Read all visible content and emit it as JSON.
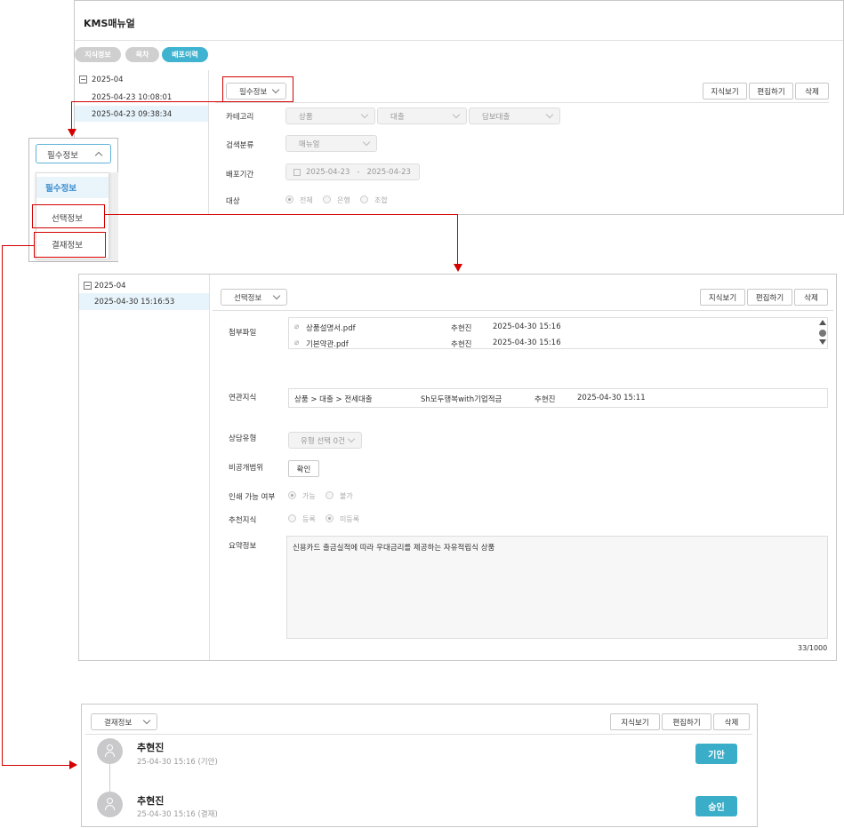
{
  "app_title": "KMS매뉴얼",
  "top_tabs": [
    "지식정보",
    "목차",
    "배포이력"
  ],
  "actions": {
    "view": "지식보기",
    "edit": "편집하기",
    "delete": "삭제"
  },
  "panel1": {
    "tree_root": "2025-04",
    "tree_items": [
      "2025-04-23 10:08:01",
      "2025-04-23 09:38:34"
    ],
    "section_select": "필수정보",
    "fields": {
      "category_label": "카테고리",
      "category_values": [
        "상품",
        "대출",
        "담보대출"
      ],
      "search_class_label": "검색분류",
      "search_class_value": "매뉴얼",
      "period_label": "배포기간",
      "period_from": "2025-04-23",
      "period_sep": "-",
      "period_to": "2025-04-23",
      "target_label": "대상",
      "target_options": [
        "전체",
        "은행",
        "조합"
      ]
    }
  },
  "dropdown_menu": {
    "selected": "필수정보",
    "items": [
      "필수정보",
      "선택정보",
      "결재정보"
    ]
  },
  "panel2": {
    "tree_root": "2025-04",
    "tree_items": [
      "2025-04-30 15:16:53"
    ],
    "section_select": "선택정보",
    "attach_label": "첨부파일",
    "files": [
      {
        "name": "상품설명서.pdf",
        "author": "추현진",
        "date": "2025-04-30 15:16"
      },
      {
        "name": "기본약관.pdf",
        "author": "추현진",
        "date": "2025-04-30 15:16"
      }
    ],
    "related_label": "연관지식",
    "related": {
      "path": "상품 > 대출 > 전세대출",
      "title": "Sh모두행복with기업적금",
      "author": "추현진",
      "date": "2025-04-30 15:11"
    },
    "consult_label": "상담유형",
    "consult_value": "유형 선택 0건",
    "private_label": "비공개범위",
    "private_btn": "확인",
    "print_label": "인쇄 가능 여부",
    "print_options": [
      "가능",
      "불가"
    ],
    "recommend_label": "추천지식",
    "recommend_options": [
      "등록",
      "미등록"
    ],
    "summary_label": "요약정보",
    "summary_text": "신용카드 출금실적에 따라 우대금리를 제공하는 자유적립식 상품",
    "char_count": "33/1000"
  },
  "panel3": {
    "section_select": "결재정보",
    "approvals": [
      {
        "name": "추현진",
        "meta": "25-04-30 15:16 (기안)",
        "badge": "기안"
      },
      {
        "name": "추현진",
        "meta": "25-04-30 15:16 (결재)",
        "badge": "승인"
      }
    ]
  },
  "colors": {
    "accent": "#3fb3cf",
    "red": "#d40000",
    "badge": "#3aaec9"
  }
}
